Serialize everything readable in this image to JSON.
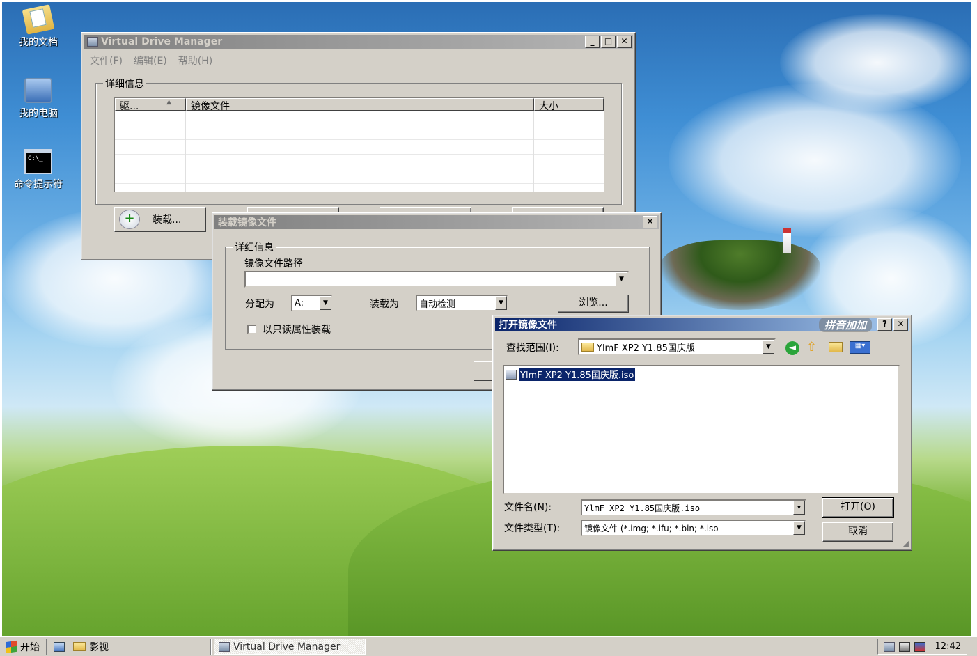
{
  "desktop": {
    "icons": [
      {
        "label": "我的文档"
      },
      {
        "label": "我的电脑"
      },
      {
        "label": "命令提示符",
        "glyph_text": "C:\\_"
      }
    ]
  },
  "vdm": {
    "title": "Virtual Drive Manager",
    "menu": [
      "文件(F)",
      "编辑(E)",
      "帮助(H)"
    ],
    "group_label": "详细信息",
    "columns": [
      "驱...",
      "镜像文件",
      "大小"
    ],
    "sort_indicator": "▲",
    "mount_button": "装载..."
  },
  "mount_dialog": {
    "title": "装载镜像文件",
    "group_label": "详细信息",
    "path_label": "镜像文件路径",
    "path_value": "",
    "assign_label": "分配为",
    "assign_value": "A:",
    "mount_as_label": "装载为",
    "mount_as_value": "自动检测",
    "browse_button": "浏览...",
    "readonly_label": "以只读属性装载"
  },
  "open_dialog": {
    "title": "打开镜像文件",
    "ime_badge": "拼音加加",
    "lookin_label": "查找范围(I):",
    "lookin_value": "YlmF XP2 Y1.85国庆版",
    "files": [
      "YlmF XP2 Y1.85国庆版.iso"
    ],
    "filename_label": "文件名(N):",
    "filename_value": "YlmF XP2 Y1.85国庆版.iso",
    "filetype_label": "文件类型(T):",
    "filetype_value": "镜像文件 (*.img; *.ifu; *.bin; *.iso",
    "open_button": "打开(O)",
    "cancel_button": "取消"
  },
  "taskbar": {
    "start_label": "开始",
    "quick_folder": "影视",
    "task_label": "Virtual Drive Manager",
    "clock": "12:42"
  }
}
